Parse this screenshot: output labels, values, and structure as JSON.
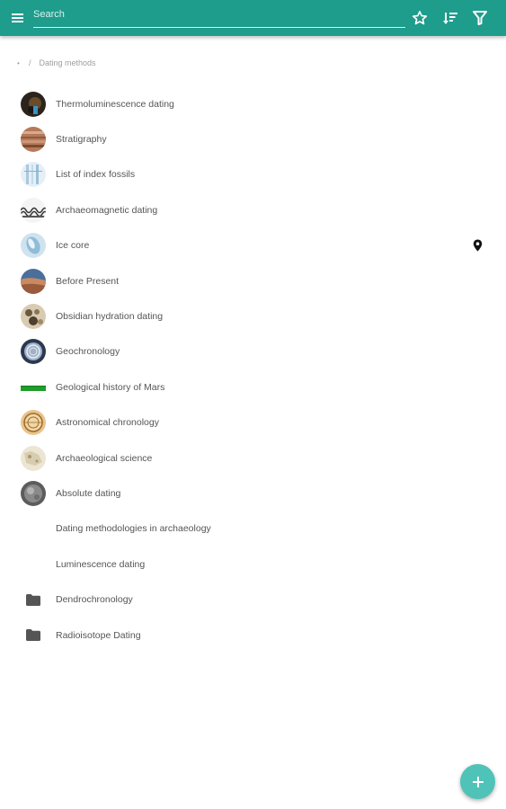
{
  "toolbar": {
    "search_placeholder": "Search",
    "accent_color": "#1e9c8c",
    "icons": [
      "menu-icon",
      "star-icon",
      "sort-icon",
      "filter-icon"
    ]
  },
  "breadcrumb": {
    "root": "•",
    "separator": "/",
    "current": "Dating methods"
  },
  "items": [
    {
      "label": "Thermoluminescence dating",
      "type": "image"
    },
    {
      "label": "Stratigraphy",
      "type": "image"
    },
    {
      "label": "List of index fossils",
      "type": "image"
    },
    {
      "label": "Archaeomagnetic dating",
      "type": "image"
    },
    {
      "label": "Ice core",
      "type": "image",
      "has_location": true
    },
    {
      "label": "Before Present",
      "type": "image"
    },
    {
      "label": "Obsidian hydration dating",
      "type": "image"
    },
    {
      "label": "Geochronology",
      "type": "image"
    },
    {
      "label": "Geological history of Mars",
      "type": "image"
    },
    {
      "label": "Astronomical chronology",
      "type": "image"
    },
    {
      "label": "Archaeological science",
      "type": "image"
    },
    {
      "label": "Absolute dating",
      "type": "image"
    },
    {
      "label": "Dating methodologies in archaeology",
      "type": "none"
    },
    {
      "label": "Luminescence dating",
      "type": "none"
    },
    {
      "label": "Dendrochronology",
      "type": "folder"
    },
    {
      "label": "Radioisotope Dating",
      "type": "folder"
    }
  ],
  "fab": {
    "icon": "plus-icon",
    "color": "#4fc3b7"
  }
}
